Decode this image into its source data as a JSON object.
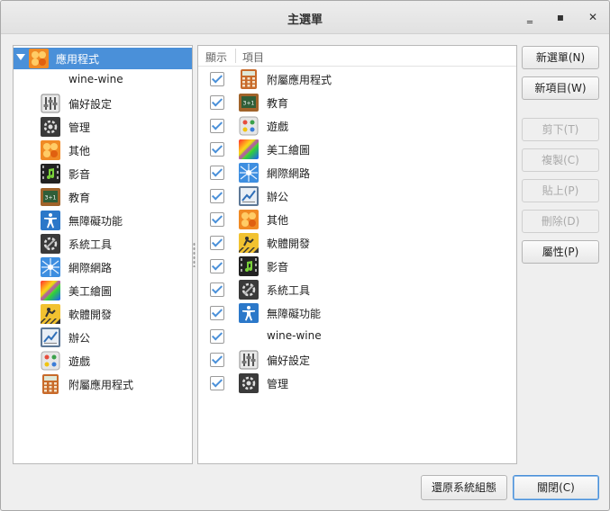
{
  "window": {
    "title": "主選單",
    "minimize_glyph": "‗",
    "maximize_glyph": "▪",
    "close_glyph": "✕"
  },
  "tree": {
    "root": {
      "label": "應用程式",
      "icon": "other-icon",
      "expanded": true,
      "selected": true
    },
    "items": [
      {
        "label": "wine-wine",
        "icon": ""
      },
      {
        "label": "偏好設定",
        "icon": "preferences-icon"
      },
      {
        "label": "管理",
        "icon": "administration-icon"
      },
      {
        "label": "其他",
        "icon": "other-icon"
      },
      {
        "label": "影音",
        "icon": "multimedia-icon"
      },
      {
        "label": "教育",
        "icon": "education-icon"
      },
      {
        "label": "無障礙功能",
        "icon": "accessibility-icon"
      },
      {
        "label": "系統工具",
        "icon": "system-tools-icon"
      },
      {
        "label": "網際網路",
        "icon": "internet-icon"
      },
      {
        "label": "美工繪圖",
        "icon": "graphics-icon"
      },
      {
        "label": "軟體開發",
        "icon": "development-icon"
      },
      {
        "label": "辦公",
        "icon": "office-icon"
      },
      {
        "label": "遊戲",
        "icon": "games-icon"
      },
      {
        "label": "附屬應用程式",
        "icon": "accessories-icon"
      }
    ]
  },
  "list": {
    "headers": {
      "show": "顯示",
      "item": "項目"
    },
    "rows": [
      {
        "label": "附屬應用程式",
        "icon": "accessories-icon",
        "checked": true
      },
      {
        "label": "教育",
        "icon": "education-icon",
        "checked": true
      },
      {
        "label": "遊戲",
        "icon": "games-icon",
        "checked": true
      },
      {
        "label": "美工繪圖",
        "icon": "graphics-icon",
        "checked": true
      },
      {
        "label": "網際網路",
        "icon": "internet-icon",
        "checked": true
      },
      {
        "label": "辦公",
        "icon": "office-icon",
        "checked": true
      },
      {
        "label": "其他",
        "icon": "other-icon",
        "checked": true
      },
      {
        "label": "軟體開發",
        "icon": "development-icon",
        "checked": true
      },
      {
        "label": "影音",
        "icon": "multimedia-icon",
        "checked": true
      },
      {
        "label": "系統工具",
        "icon": "system-tools-icon",
        "checked": true
      },
      {
        "label": "無障礙功能",
        "icon": "accessibility-icon",
        "checked": true
      },
      {
        "label": "wine-wine",
        "icon": "",
        "checked": true
      },
      {
        "label": "偏好設定",
        "icon": "preferences-icon",
        "checked": true
      },
      {
        "label": "管理",
        "icon": "administration-icon",
        "checked": true
      }
    ]
  },
  "side_buttons": [
    {
      "label": "新選單(N)",
      "enabled": true
    },
    {
      "label": "新項目(W)",
      "enabled": true
    },
    {
      "label": "剪下(T)",
      "enabled": false
    },
    {
      "label": "複製(C)",
      "enabled": false
    },
    {
      "label": "貼上(P)",
      "enabled": false
    },
    {
      "label": "刪除(D)",
      "enabled": false
    },
    {
      "label": "屬性(P)",
      "enabled": true
    }
  ],
  "bottom_buttons": {
    "revert": "還原系統組態",
    "close": "關閉(C)"
  },
  "colors": {
    "selection": "#4a90d9",
    "accent_check": "#4a90d9"
  }
}
